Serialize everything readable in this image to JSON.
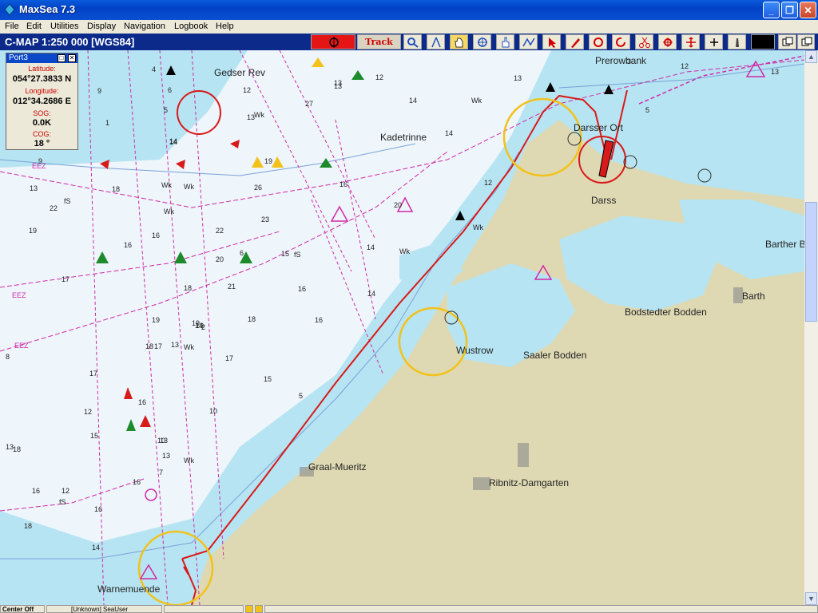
{
  "window": {
    "title": "MaxSea 7.3"
  },
  "menu": [
    "File",
    "Edit",
    "Utilities",
    "Display",
    "Navigation",
    "Logbook",
    "Help"
  ],
  "toolbar": {
    "chart_name": "C-MAP  1:250 000 [WGS84]",
    "track_label": "Track on"
  },
  "panel": {
    "title": "Port3",
    "latitude_label": "Latitude:",
    "latitude": "054°27.3833 N",
    "longitude_label": "Longitude:",
    "longitude": "012°34.2686 E",
    "sog_label": "SOG:",
    "sog": "0.0K",
    "cog_label": "COG:",
    "cog": "18 °"
  },
  "places": [
    "Gedser Rev",
    "Kadetrinne",
    "Prerowbank",
    "Darsser Ort",
    "Darss",
    "Barther Bodden",
    "Barth",
    "Bodstedter Bodden",
    "Wustrow",
    "Saaler Bodden",
    "Graal-Mueritz",
    "Ribnitz-Damgarten",
    "Warnemuende"
  ],
  "depths": [
    "4",
    "6",
    "9",
    "5",
    "1",
    "14",
    "12",
    "13",
    "13",
    "14",
    "12",
    "14",
    "7",
    "9",
    "22",
    "19",
    "18",
    "16",
    "21",
    "17",
    "18",
    "14",
    "15",
    "27",
    "16",
    "16",
    "14",
    "19",
    "20",
    "26",
    "23",
    "22",
    "13",
    "8",
    "6",
    "13",
    "3",
    "5",
    "13",
    "14",
    "17",
    "16",
    "20",
    "12",
    "12",
    "14",
    "19",
    "18",
    "18",
    "17",
    "19",
    "16",
    "15",
    "13",
    "15",
    "12",
    "16",
    "18",
    "14",
    "16",
    "13",
    "10",
    "5",
    "7",
    "12",
    "10",
    "13",
    "16",
    "16",
    "13",
    "18",
    "13",
    "17",
    "19",
    "2",
    "5"
  ],
  "legend_marks": {
    "eez": "EEZ",
    "wk": "Wk",
    "fs": "fS"
  },
  "status": {
    "cell1": "Center Off",
    "cell2": "[Unknown]  SeaUser"
  },
  "colors": {
    "land": "#ded9b3",
    "shallow": "#b6e4f2",
    "deep": "#eef5fb",
    "route": "#d81a1a"
  }
}
